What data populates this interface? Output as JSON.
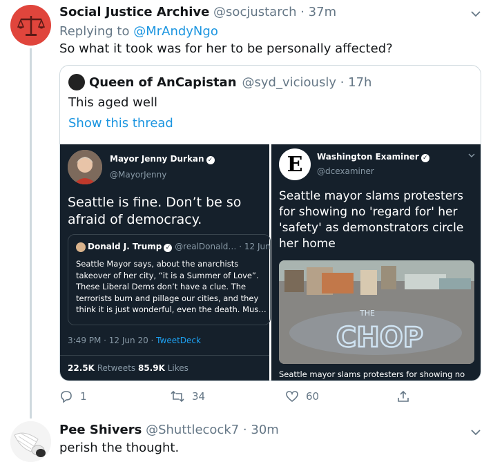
{
  "tweet1": {
    "name": "Social Justice Archive",
    "handle": "@socjustarch · 37m",
    "replying_prefix": "Replying to ",
    "replying_to": "@MrAndyNgo",
    "text": "So what it took was for her to be personally affected?",
    "avatar_icon": "scales-icon",
    "avatar_color": "#e0453c"
  },
  "quote": {
    "name": "Queen of AnCapistan",
    "handle": "@syd_viciously · 17h",
    "text": "This aged well",
    "show_thread": "Show this thread"
  },
  "image_left": {
    "name": "Mayor Jenny Durkan",
    "handle": "@MayorJenny",
    "text": "Seattle is fine. Don’t be so afraid of democracy.",
    "inner_quote": {
      "name": "Donald J. Trump",
      "handle": "@realDonald… · 12 Jun",
      "text": "Seattle Mayor says, about the anarchists takeover of her city, “it is a Summer of Love”. These Liberal Dems don’t have a clue. The terrorists burn and pillage our cities, and they think it is just wonderful, even the death. Mus…"
    },
    "time": "3:49 PM · 12 Jun 20 · ",
    "source": "TweetDeck",
    "retweets_count": "22.5K",
    "retweets_label": " Retweets ",
    "likes_count": "85.9K",
    "likes_label": " Likes"
  },
  "image_right": {
    "name": "Washington Examiner",
    "handle": "@dcexaminer",
    "logo_letter": "E",
    "text": "Seattle mayor slams protesters for showing no 'regard for' her 'safety' as demonstrators circle her home",
    "photo_text": "CHOP",
    "caption": "Seattle mayor slams protesters for showing no"
  },
  "actions": {
    "replies": "1",
    "retweets": "34",
    "likes": "60"
  },
  "tweet2": {
    "name": "Pee Shivers",
    "handle": "@Shuttlecock7 · 30m",
    "text": "perish the thought."
  },
  "colors": {
    "link": "#1b95e0",
    "muted": "#657786",
    "dark_bg": "#15202b"
  }
}
